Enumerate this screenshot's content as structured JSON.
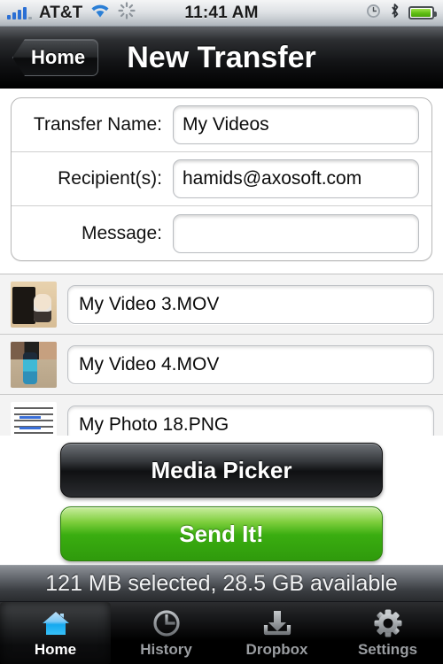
{
  "status_bar": {
    "carrier": "AT&T",
    "time": "11:41 AM",
    "icons": [
      "signal-bars-icon",
      "wifi-icon",
      "activity-spinner-icon",
      "alarm-clock-icon",
      "bluetooth-icon",
      "battery-icon"
    ]
  },
  "nav_bar": {
    "back_label": "Home",
    "title": "New Transfer"
  },
  "form": {
    "fields": [
      {
        "label": "Transfer Name:",
        "value": "My Videos",
        "placeholder": ""
      },
      {
        "label": "Recipient(s):",
        "value": "hamids@axosoft.com",
        "placeholder": ""
      },
      {
        "label": "Message:",
        "value": "",
        "placeholder": ""
      }
    ]
  },
  "file_list": {
    "items": [
      {
        "name": "My Video 3.MOV",
        "thumb": "child-at-piano-photo"
      },
      {
        "name": "My Video 4.MOV",
        "thumb": "child-on-tiled-floor-photo"
      },
      {
        "name": "My Photo 18.PNG",
        "thumb": "document-screenshot-photo"
      }
    ]
  },
  "actions": {
    "media_picker_label": "Media Picker",
    "send_label": "Send It!"
  },
  "info_bar": {
    "text": "121 MB selected, 28.5 GB available"
  },
  "tab_bar": {
    "tabs": [
      {
        "label": "Home",
        "icon": "house-icon",
        "active": true
      },
      {
        "label": "History",
        "icon": "clock-icon",
        "active": false
      },
      {
        "label": "Dropbox",
        "icon": "download-inbox-icon",
        "active": false
      },
      {
        "label": "Settings",
        "icon": "gear-icon",
        "active": false
      }
    ]
  },
  "colors": {
    "accent_blue": "#2b6fd4",
    "send_green": "#3aad10",
    "nav_black": "#000000",
    "active_tab_blue": "#37b6f0"
  }
}
